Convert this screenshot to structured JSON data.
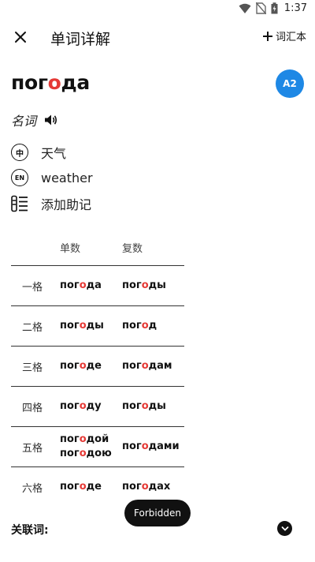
{
  "status_bar": {
    "time": "1:37",
    "icons": [
      "wifi-icon",
      "no-sim-icon",
      "battery-icon"
    ]
  },
  "app_bar": {
    "title": "单词详解",
    "vocab_label": "词汇本",
    "close_icon": "close-icon",
    "add_icon": "plus-icon"
  },
  "word": {
    "prefix": "пог",
    "stress": "о",
    "suffix": "да",
    "level": "A2"
  },
  "part_of_speech": "名词",
  "meanings": {
    "chinese_icon": "中",
    "chinese": "天气",
    "english_icon": "EN",
    "english": "weather",
    "mnemonic": "添加助记"
  },
  "declension": {
    "headers": {
      "singular": "单数",
      "plural": "复数"
    },
    "rows": [
      {
        "case": "一格",
        "sg": [
          [
            "пог",
            "о",
            "да"
          ]
        ],
        "pl": [
          [
            "пог",
            "о",
            "ды"
          ]
        ]
      },
      {
        "case": "二格",
        "sg": [
          [
            "пог",
            "о",
            "ды"
          ]
        ],
        "pl": [
          [
            "пог",
            "о",
            "д"
          ]
        ]
      },
      {
        "case": "三格",
        "sg": [
          [
            "пог",
            "о",
            "де"
          ]
        ],
        "pl": [
          [
            "пог",
            "о",
            "дам"
          ]
        ]
      },
      {
        "case": "四格",
        "sg": [
          [
            "пог",
            "о",
            "ду"
          ]
        ],
        "pl": [
          [
            "пог",
            "о",
            "ды"
          ]
        ]
      },
      {
        "case": "五格",
        "sg": [
          [
            "пог",
            "о",
            "дой"
          ],
          [
            "пог",
            "о",
            "дою"
          ]
        ],
        "pl": [
          [
            "пог",
            "о",
            "дами"
          ]
        ]
      },
      {
        "case": "六格",
        "sg": [
          [
            "пог",
            "о",
            "де"
          ]
        ],
        "pl": [
          [
            "пог",
            "о",
            "дах"
          ]
        ]
      }
    ]
  },
  "toast": "Forbidden",
  "related": {
    "label": "关联词:"
  },
  "colors": {
    "accent": "#1e88e5",
    "stress": "#e53935"
  }
}
